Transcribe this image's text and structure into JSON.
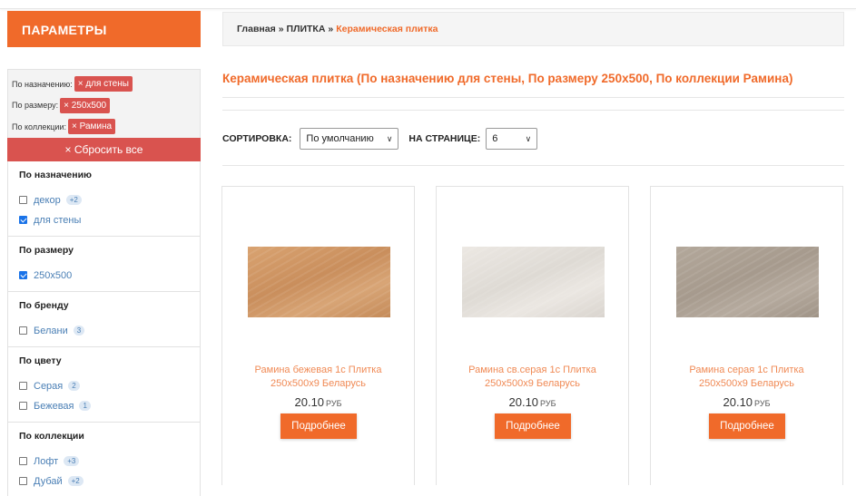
{
  "sidebar": {
    "title": "ПАРАМЕТРЫ",
    "active_filters": [
      {
        "label": "По назначению:",
        "chip": "× для стены"
      },
      {
        "label": "По размеру:",
        "chip": "× 250x500"
      },
      {
        "label": "По коллекции:",
        "chip": "× Рамина"
      }
    ],
    "reset_label": "× Сбросить все",
    "groups": [
      {
        "title": "По назначению",
        "options": [
          {
            "label": "декор",
            "count": "+2",
            "checked": false
          },
          {
            "label": "для стены",
            "count": "",
            "checked": true
          }
        ]
      },
      {
        "title": "По размеру",
        "options": [
          {
            "label": "250x500",
            "count": "",
            "checked": true
          }
        ]
      },
      {
        "title": "По бренду",
        "options": [
          {
            "label": "Белани",
            "count": "3",
            "checked": false
          }
        ]
      },
      {
        "title": "По цвету",
        "options": [
          {
            "label": "Серая",
            "count": "2",
            "checked": false
          },
          {
            "label": "Бежевая",
            "count": "1",
            "checked": false
          }
        ]
      },
      {
        "title": "По коллекции",
        "options": [
          {
            "label": "Лофт",
            "count": "+3",
            "checked": false
          },
          {
            "label": "Дубай",
            "count": "+2",
            "checked": false
          }
        ]
      }
    ]
  },
  "breadcrumb": {
    "home": "Главная",
    "separator": "»",
    "section": "ПЛИТКА",
    "current": "Керамическая плитка"
  },
  "page_title": "Керамическая плитка (По назначению для стены, По размеру 250x500, По коллекции Рамина)",
  "sort": {
    "sort_label": "СОРТИРОВКА:",
    "sort_value": "По умолчанию",
    "per_page_label": "НА СТРАНИЦЕ:",
    "per_page_value": "6"
  },
  "products": [
    {
      "name": "Рамина бежевая 1с Плитка 250x500x9 Беларусь",
      "price": "20.10",
      "currency": "РУБ",
      "button": "Подробнее",
      "tile": "beige"
    },
    {
      "name": "Рамина св.серая 1с Плитка 250x500x9 Беларусь",
      "price": "20.10",
      "currency": "РУБ",
      "button": "Подробнее",
      "tile": "lightgrey"
    },
    {
      "name": "Рамина серая 1с Плитка 250x500x9 Беларусь",
      "price": "20.10",
      "currency": "РУБ",
      "button": "Подробнее",
      "tile": "grey"
    }
  ],
  "colors": {
    "accent": "#f06a2a",
    "chip": "#d9534f",
    "link": "#4a7fb5"
  }
}
